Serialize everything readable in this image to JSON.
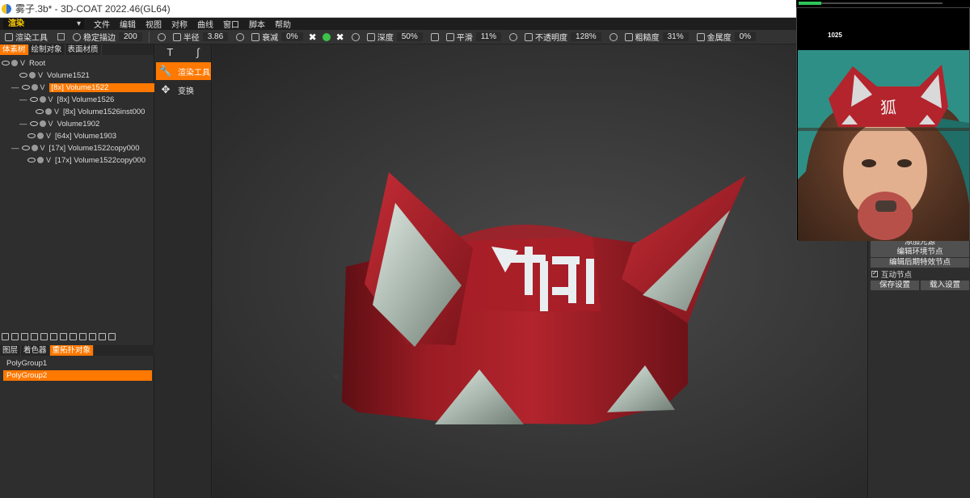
{
  "window": {
    "title": "雾子.3b* - 3D-COAT 2022.46(GL64)"
  },
  "menubar": {
    "room": "渲染",
    "items": [
      "文件",
      "编辑",
      "视图",
      "对称",
      "曲线",
      "窗口",
      "脚本",
      "帮助"
    ]
  },
  "options": {
    "tool_label": "渲染工具",
    "stabilize_label": "稳定描边",
    "stabilize_value": "200",
    "radius_label": "半径",
    "radius_value": "3.86",
    "falloff_label": "衰减",
    "falloff_value": "0%",
    "depth_label": "深度",
    "depth_value": "50%",
    "smooth_label": "平滑",
    "smooth_value": "11%",
    "opacity_label": "不透明度",
    "opacity_value": "128%",
    "roughness_label": "粗糙度",
    "roughness_value": "31%",
    "metalness_label": "金属度",
    "metalness_value": "0%"
  },
  "left_panel": {
    "tabs": [
      "体素树",
      "绘制对象",
      "表面材质"
    ],
    "tree": [
      {
        "label": "Root"
      },
      {
        "label": "Volume1521"
      },
      {
        "label": "[8x]  Volume1522",
        "selected": true
      },
      {
        "label": "[8x]  Volume1526"
      },
      {
        "label": "[8x]  Volume1526inst000"
      },
      {
        "label": "Volume1902"
      },
      {
        "label": "[64x]  Volume1903"
      },
      {
        "label": "[17x]  Volume1522copy000"
      },
      {
        "label": "[17x]  Volume1522copy000"
      }
    ],
    "bottom_tabs": [
      "图层",
      "着色器",
      "重拓扑对象"
    ],
    "polygroups": [
      "PolyGroup1",
      "PolyGroup2"
    ]
  },
  "tool_panel": {
    "items": [
      {
        "label": "渲染工具",
        "icon": "wrench-icon"
      },
      {
        "label": "变换",
        "icon": "move-arrows-icon"
      }
    ]
  },
  "right_panel": {
    "buttons": [
      "添加光源",
      "编辑环境节点",
      "编辑后期特效节点"
    ],
    "checkbox_label": "互动节点",
    "save_label": "保存设置",
    "load_label": "载入设置"
  },
  "reference": {
    "counter": "1025",
    "emblem": "狐"
  },
  "colors": {
    "accent": "#ff7800",
    "helmet_red": "#a51d25",
    "panel": "#2e2e2e"
  }
}
